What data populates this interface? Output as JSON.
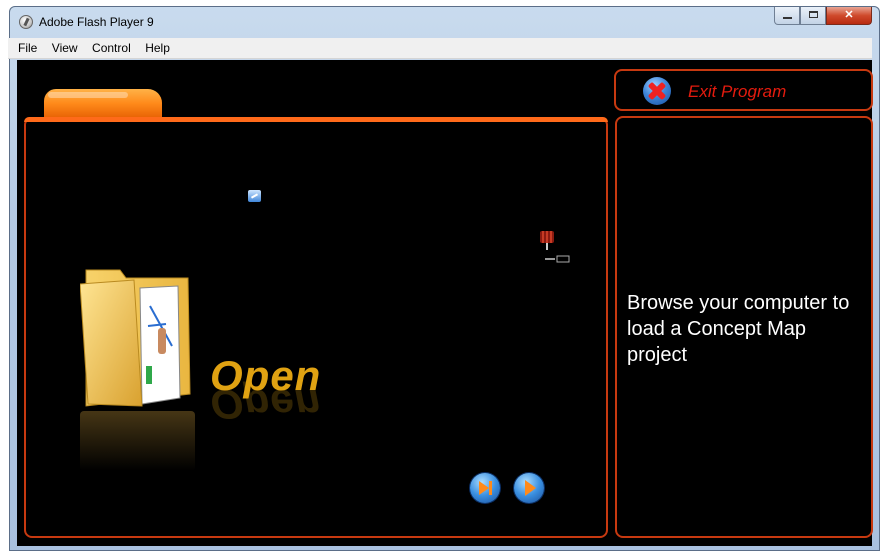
{
  "window": {
    "title": "Adobe Flash Player 9",
    "controls": [
      "minimize",
      "maximize",
      "close"
    ]
  },
  "menu": {
    "items": [
      "File",
      "View",
      "Control",
      "Help"
    ]
  },
  "app": {
    "exit_label": "Exit Program",
    "open_label": "Open",
    "info_text": "Browse your computer to load a Concept Map project",
    "accent_color": "#ff6a1a",
    "border_color": "#c73910",
    "exit_color": "#e41b0e",
    "open_color": "#e0a212"
  },
  "icons": {
    "exit": "exit-x-icon",
    "folder": "folder-icon",
    "nav_next": "skip-forward-icon",
    "nav_play": "play-icon"
  }
}
